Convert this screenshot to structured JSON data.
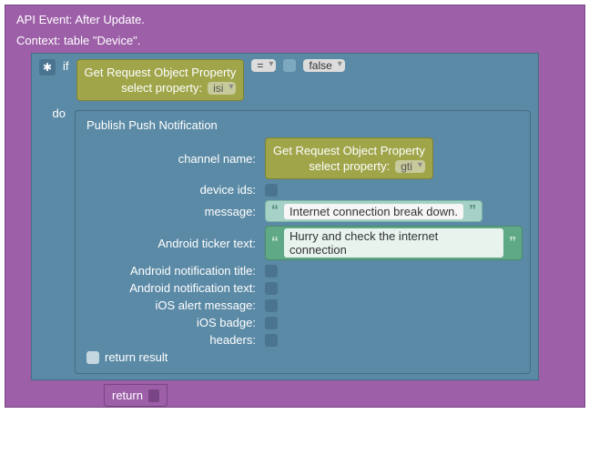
{
  "outer": {
    "title1": "API Event: After Update.",
    "title2": "Context: table \"Device\"."
  },
  "ifblock": {
    "if_label": "if",
    "do_label": "do"
  },
  "getprop1": {
    "title": "Get Request Object Property",
    "select_label": "select property:",
    "value": "isi"
  },
  "compare": {
    "op": "=",
    "rhs": "false"
  },
  "publish": {
    "title": "Publish Push Notification",
    "fields": {
      "channel": "channel name:",
      "device_ids": "device ids:",
      "message": "message:",
      "android_ticker": "Android ticker text:",
      "android_title": "Android notification title:",
      "android_text": "Android notification text:",
      "ios_alert": "iOS alert message:",
      "ios_badge": "iOS badge:",
      "headers": "headers:"
    },
    "return_result": "return result"
  },
  "getprop2": {
    "title": "Get Request Object Property",
    "select_label": "select property:",
    "value": "gti"
  },
  "messages": {
    "msg1": "Internet connection break down.",
    "msg2": "Hurry and check the internet connection"
  },
  "return_label": "return"
}
